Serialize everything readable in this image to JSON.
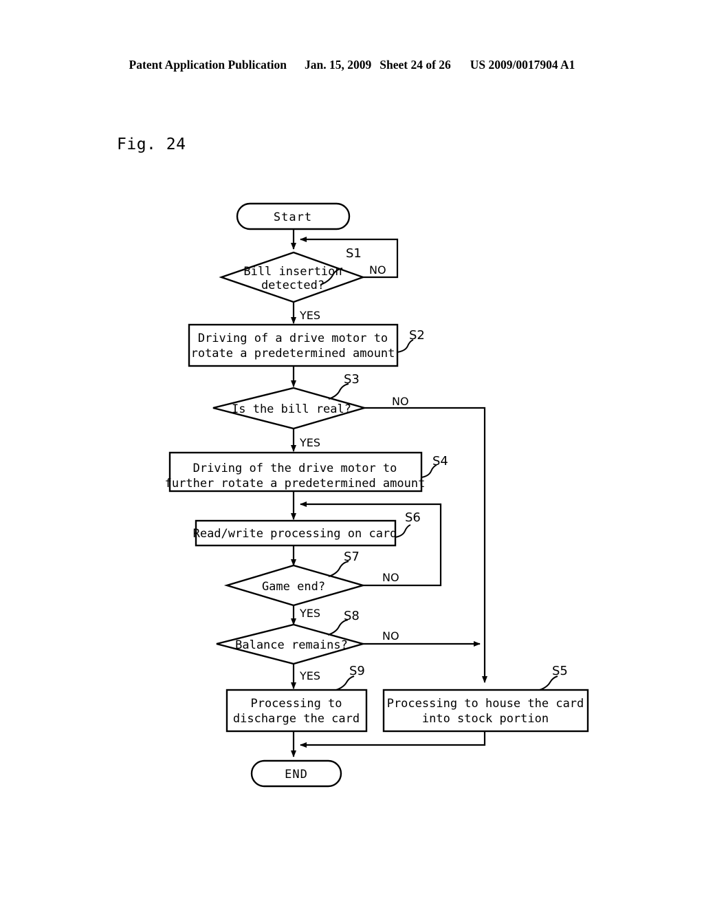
{
  "header": {
    "publication": "Patent Application Publication",
    "date": "Jan. 15, 2009",
    "sheet": "Sheet 24 of 26",
    "patent_number": "US 2009/0017904 A1"
  },
  "figure": {
    "label": "Fig. 24"
  },
  "flowchart": {
    "start": {
      "label": "Start"
    },
    "end": {
      "label": "END"
    },
    "steps": {
      "s1": {
        "id": "S1",
        "type": "decision",
        "text_line1": "Bill insertion",
        "text_line2": "detected?",
        "yes": "YES",
        "no": "NO"
      },
      "s2": {
        "id": "S2",
        "type": "process",
        "text_line1": "Driving of a drive motor to",
        "text_line2": "rotate a predetermined amount"
      },
      "s3": {
        "id": "S3",
        "type": "decision",
        "text_line1": "Is the bill real?",
        "yes": "YES",
        "no": "NO"
      },
      "s4": {
        "id": "S4",
        "type": "process",
        "text_line1": "Driving of the drive motor to",
        "text_line2": "further rotate a predetermined amount"
      },
      "s6": {
        "id": "S6",
        "type": "process",
        "text_line1": "Read/write processing on card"
      },
      "s7": {
        "id": "S7",
        "type": "decision",
        "text_line1": "Game end?",
        "yes": "YES",
        "no": "NO"
      },
      "s8": {
        "id": "S8",
        "type": "decision",
        "text_line1": "Balance remains?",
        "yes": "YES",
        "no": "NO"
      },
      "s9": {
        "id": "S9",
        "type": "process",
        "text_line1": "Processing to",
        "text_line2": "discharge the card"
      },
      "s5": {
        "id": "S5",
        "type": "process",
        "text_line1": "Processing to house the card",
        "text_line2": "into stock portion"
      }
    }
  },
  "colors": {
    "ink": "#000000",
    "paper": "#ffffff"
  }
}
